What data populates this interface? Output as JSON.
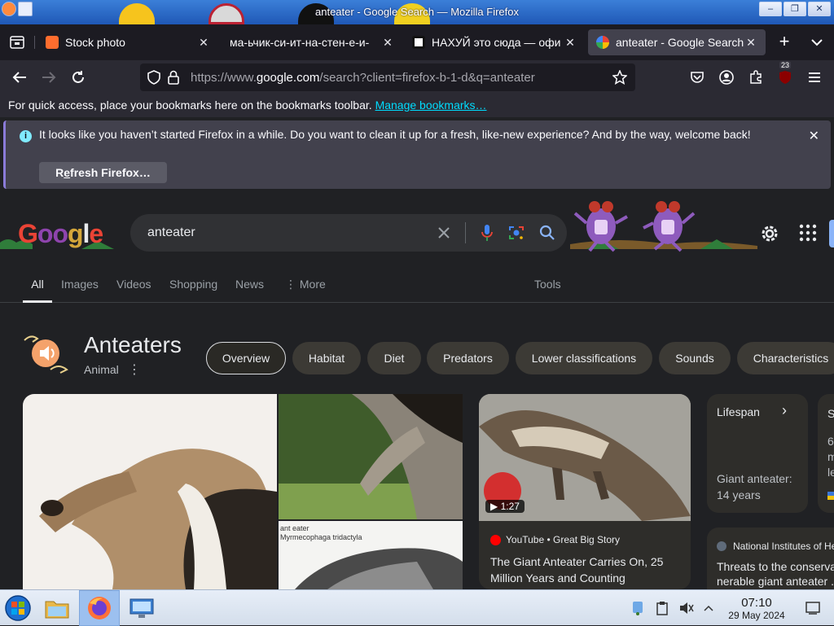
{
  "window": {
    "title": "anteater - Google Search — Mozilla Firefox",
    "buttons": [
      "–",
      "❐",
      "✕"
    ]
  },
  "tabs": [
    {
      "label": "Stock photo",
      "favicon_color": "#ff6d2e",
      "active": false
    },
    {
      "label": "ма-ьчик-си-ит-на-стен-е-и-",
      "favicon_color": "",
      "active": false
    },
    {
      "label": "НАХУЙ это сюда — офи",
      "favicon_color": "#ffffff",
      "active": false
    },
    {
      "label": "anteater - Google Search",
      "favicon_color": "#4285f4",
      "active": true
    }
  ],
  "navbar": {
    "url_prefix": "https://www.",
    "url_domain": "google.com",
    "url_rest": "/search?client=firefox-b-1-d&q=anteater",
    "extension_badge": "23"
  },
  "bookmarks_bar": {
    "message": "For quick access, place your bookmarks here on the bookmarks toolbar.",
    "link": "Manage bookmarks…"
  },
  "notification": {
    "message": "It looks like you haven’t started Firefox in a while. Do you want to clean it up for a fresh, like-new experience? And by the way, welcome back!",
    "button": "Refresh Firefox…",
    "button_prefix": "R",
    "button_accesskey": "e",
    "button_suffix": "fresh Firefox…"
  },
  "google": {
    "logo": "Google",
    "query": "anteater",
    "tabs": [
      "All",
      "Images",
      "Videos",
      "Shopping",
      "News",
      "More"
    ],
    "tools": "Tools",
    "knowledge_panel": {
      "title": "Anteaters",
      "subtitle": "Animal",
      "chips": [
        "Overview",
        "Habitat",
        "Diet",
        "Predators",
        "Lower classifications",
        "Sounds",
        "Characteristics"
      ]
    },
    "image_caption_lines": [
      "ant eater",
      "Myrmecophaga tridactyla"
    ],
    "video": {
      "duration": "1:27",
      "source": "YouTube • Great Big Story",
      "title": "The Giant Anteater Carries On, 25 Million Years and Counting"
    },
    "lifespan": {
      "label": "Lifespan",
      "line1": "Giant anteater:",
      "line2": "14 years"
    },
    "partial_card": {
      "letter": "S",
      "line1": "6",
      "line2": "m",
      "line3": "le"
    },
    "nih": {
      "source": "National Institutes of He",
      "line1": "Threats to the conserva",
      "line2": "nerable giant anteater ."
    }
  },
  "taskbar": {
    "time": "07:10",
    "date": "29 May 2024"
  },
  "colors": {
    "firefox_dark": "#1c1b22",
    "toolbar": "#2b2a33",
    "google_bg": "#202124",
    "link": "#00ddff"
  }
}
